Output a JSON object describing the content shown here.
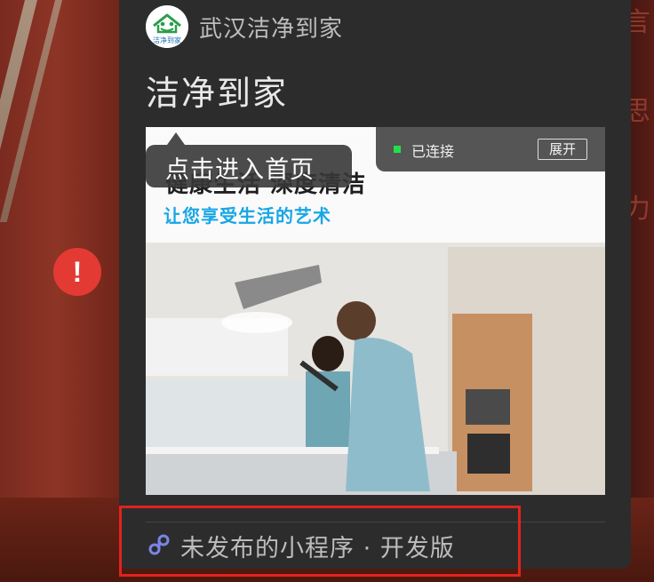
{
  "header": {
    "brand_name": "武汉洁净到家",
    "logo_text": "洁净到家",
    "page_title": "洁净到家"
  },
  "tooltip": {
    "text": "点击进入首页"
  },
  "connection": {
    "status": "已连接",
    "expand_label": "展开",
    "status_color": "#22e04a"
  },
  "banner": {
    "headline": "健康生活  深度清洁",
    "subline": "让您享受生活的艺术"
  },
  "footer": {
    "text": "未发布的小程序 · 开发版",
    "highlight_color": "#e0231f"
  },
  "alert": {
    "icon": "exclamation-icon",
    "color": "#e33a34",
    "symbol": "!"
  },
  "background": {
    "calligraphy": [
      "言",
      "思",
      "力"
    ]
  }
}
